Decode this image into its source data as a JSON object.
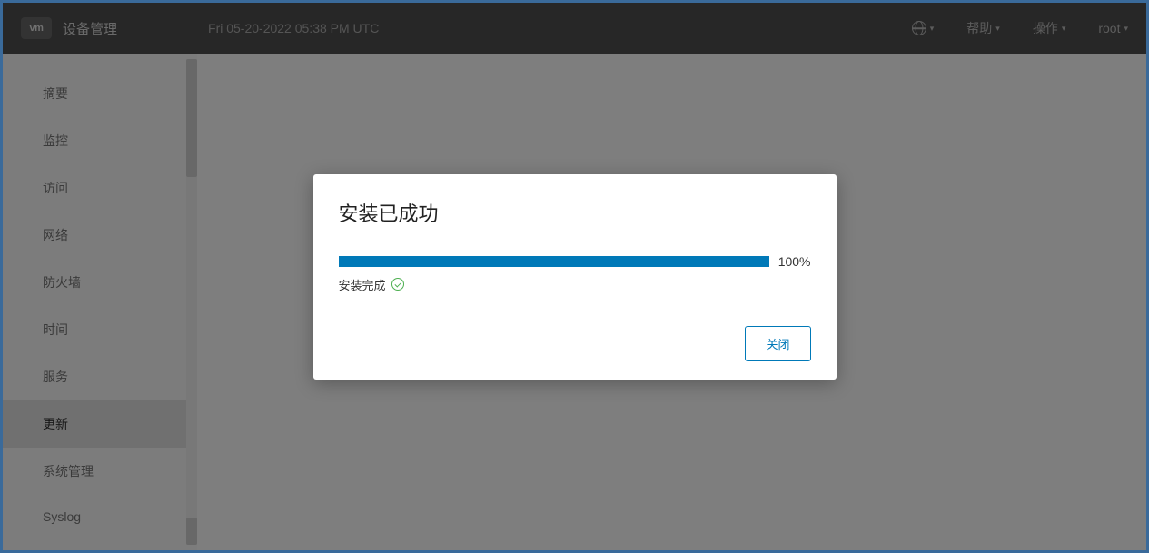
{
  "header": {
    "logo_text": "vm",
    "app_title": "设备管理",
    "timestamp": "Fri 05-20-2022 05:38 PM UTC",
    "help_label": "帮助",
    "actions_label": "操作",
    "user_label": "root"
  },
  "sidebar": {
    "items": [
      {
        "label": "摘要",
        "active": false
      },
      {
        "label": "监控",
        "active": false
      },
      {
        "label": "访问",
        "active": false
      },
      {
        "label": "网络",
        "active": false
      },
      {
        "label": "防火墙",
        "active": false
      },
      {
        "label": "时间",
        "active": false
      },
      {
        "label": "服务",
        "active": false
      },
      {
        "label": "更新",
        "active": true
      },
      {
        "label": "系统管理",
        "active": false
      },
      {
        "label": "Syslog",
        "active": false
      }
    ]
  },
  "modal": {
    "title": "安装已成功",
    "progress_pct": "100%",
    "status_text": "安装完成",
    "close_label": "关闭"
  }
}
